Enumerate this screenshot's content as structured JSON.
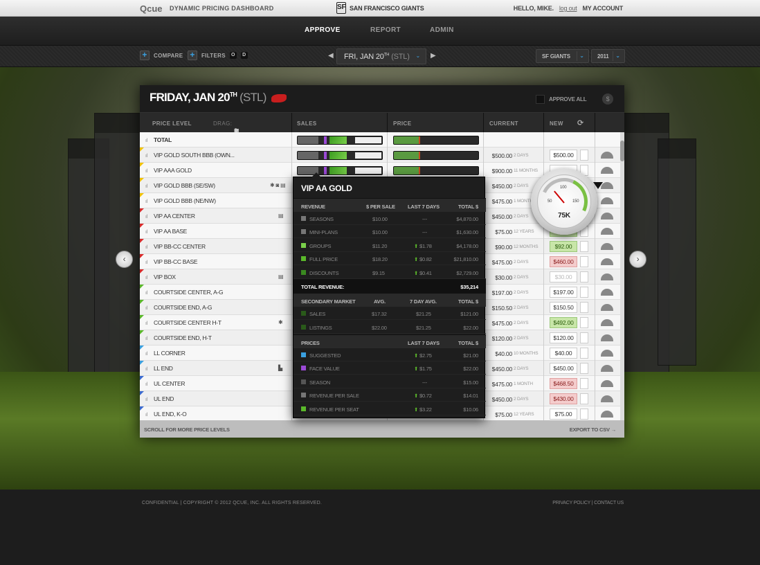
{
  "header": {
    "brand": "Qcue",
    "brand_sub": "DYNAMIC PRICING DASHBOARD",
    "team": "SAN FRANCISCO GIANTS",
    "team_logo": "SF",
    "greeting": "HELLO, MIKE.",
    "logout": "log out",
    "account": "MY ACCOUNT"
  },
  "nav": {
    "tabs": [
      "APPROVE",
      "REPORT",
      "ADMIN"
    ],
    "active": "APPROVE"
  },
  "filters": {
    "compare": "COMPARE",
    "filters": "FILTERS",
    "toggle_o": "O",
    "toggle_d": "D",
    "date_main": "FRI, JAN 20",
    "date_sup": "TH",
    "date_opp": "(STL)",
    "team_select": "SF GIANTS",
    "year_select": "2011"
  },
  "card": {
    "title_main": "FRIDAY, JAN 20",
    "title_sup": "TH",
    "title_opp": "(STL)",
    "approve_all": "APPROVE ALL",
    "dollar": "$",
    "columns": {
      "price_level": "PRICE LEVEL",
      "drag": "DRAG:",
      "sales": "SALES",
      "price": "PRICE",
      "current": "CURRENT",
      "new": "NEW"
    },
    "scroll_more": "SCROLL FOR MORE PRICE LEVELS",
    "export": "EXPORT TO CSV →"
  },
  "rows": [
    {
      "name": "TOTAL",
      "current": "",
      "days": "",
      "new": "",
      "bold": true,
      "mark": ""
    },
    {
      "name": "VIP GOLD SOUTH BBB (OWN...",
      "current": "$500.00",
      "days": "2 DAYS",
      "new": "$500.00",
      "state": "",
      "mark": "#f2c200"
    },
    {
      "name": "VIP AAA GOLD",
      "current": "$900.00",
      "days": "11 MONTHS",
      "new": "",
      "state": "",
      "mark": "#f2c200"
    },
    {
      "name": "VIP GOLD BBB (SE/SW)",
      "current": "$450.00",
      "days": "2 DAYS",
      "new": "",
      "state": "",
      "mark": "#f2c200",
      "icons": "✱ ◙ ▤"
    },
    {
      "name": "VIP GOLD BBB (NE/NW)",
      "current": "$475.00",
      "days": "1 MONTH",
      "new": "",
      "state": "",
      "mark": "#f2c200"
    },
    {
      "name": "VIP AA CENTER",
      "current": "$450.00",
      "days": "2 DAYS",
      "new": "",
      "state": "",
      "mark": "#d92a2a",
      "icons": "▤"
    },
    {
      "name": "VIP AA BASE",
      "current": "$75.00",
      "days": "12 YEARS",
      "new": "$89.50",
      "state": "green",
      "mark": "#d92a2a"
    },
    {
      "name": "VIP BB-CC CENTER",
      "current": "$90.00",
      "days": "12 MONTHS",
      "new": "$92.00",
      "state": "green",
      "mark": "#d92a2a"
    },
    {
      "name": "VIP BB-CC BASE",
      "current": "$475.00",
      "days": "2 DAYS",
      "new": "$460.00",
      "state": "red",
      "mark": "#d92a2a"
    },
    {
      "name": "VIP BOX",
      "current": "$30.00",
      "days": "2 DAYS",
      "new": "$30.00",
      "state": "dim",
      "mark": "#d92a2a",
      "icons": "▤"
    },
    {
      "name": "COURTSIDE CENTER, A-G",
      "current": "$197.00",
      "days": "2 DAYS",
      "new": "$197.00",
      "state": "",
      "mark": "#5ab82a"
    },
    {
      "name": "COURTSIDE END, A-G",
      "current": "$150.50",
      "days": "2 DAYS",
      "new": "$150.50",
      "state": "",
      "mark": "#5ab82a"
    },
    {
      "name": "COURTSIDE CENTER H-T",
      "current": "$475.00",
      "days": "2 DAYS",
      "new": "$492.00",
      "state": "green",
      "mark": "#5ab82a",
      "icons": "✱"
    },
    {
      "name": "COURTSIDE END, H-T",
      "current": "$120.00",
      "days": "2 DAYS",
      "new": "$120.00",
      "state": "",
      "mark": "#5ab82a"
    },
    {
      "name": "LL CORNER",
      "current": "$40.00",
      "days": "10 MONTHS",
      "new": "$40.00",
      "state": "",
      "mark": "#3aa0e0"
    },
    {
      "name": "LL END",
      "current": "$450.00",
      "days": "2 DAYS",
      "new": "$450.00",
      "state": "",
      "mark": "#3aa0e0",
      "icons": "▙"
    },
    {
      "name": "UL CENTER",
      "current": "$475.00",
      "days": "1 MONTH",
      "new": "$468.50",
      "state": "red",
      "mark": "#3a6ad0"
    },
    {
      "name": "UL END",
      "current": "$450.00",
      "days": "2 DAYS",
      "new": "$430.00",
      "state": "red",
      "mark": "#3a6ad0"
    },
    {
      "name": "UL END, K-O",
      "current": "$75.00",
      "days": "12 YEARS",
      "new": "$75.00",
      "state": "",
      "mark": "#3a6ad0"
    }
  ],
  "popup": {
    "title": "VIP AA GOLD",
    "revenue_hd": {
      "c1": "REVENUE",
      "c2": "$ PER SALE",
      "c3": "LAST 7 DAYS",
      "c4": "TOTAL $"
    },
    "revenue": [
      {
        "label": "SEASONS",
        "per": "$10.00",
        "last7": "---",
        "total": "$4,870.00",
        "color": "#777",
        "up": false
      },
      {
        "label": "MINI-PLANS",
        "per": "$10.00",
        "last7": "---",
        "total": "$1,630.00",
        "color": "#777",
        "up": false
      },
      {
        "label": "GROUPS",
        "per": "$11.20",
        "last7": "$1.78",
        "total": "$4,178.00",
        "color": "#7ad04a",
        "up": true
      },
      {
        "label": "FULL PRICE",
        "per": "$18.20",
        "last7": "$0.82",
        "total": "$21,810.00",
        "color": "#5ab82a",
        "up": true
      },
      {
        "label": "DISCOUNTS",
        "per": "$9.15",
        "last7": "$0.41",
        "total": "$2,729.00",
        "color": "#3a8a20",
        "up": true
      }
    ],
    "total_label": "TOTAL REVENUE:",
    "total_value": "$35,214",
    "secondary_hd": {
      "c1": "SECONDARY MARKET",
      "c2": "AVG.",
      "c3": "7 DAY AVG.",
      "c4": "TOTAL $"
    },
    "secondary": [
      {
        "label": "SALES",
        "avg": "$17.32",
        "avg7": "$21.25",
        "total": "$121.00",
        "color": "#2a5a1a"
      },
      {
        "label": "LISTINGS",
        "avg": "$22.00",
        "avg7": "$21.25",
        "total": "$22.00",
        "color": "#2a5a1a"
      }
    ],
    "prices_hd": {
      "c1": "PRICES",
      "c3": "LAST 7 DAYS",
      "c4": "TOTAL $"
    },
    "prices": [
      {
        "label": "SUGGESTED",
        "last7": "$2.75",
        "total": "$21.00",
        "color": "#3aa0e0",
        "up": true
      },
      {
        "label": "FACE VALUE",
        "last7": "$1.75",
        "total": "$22.00",
        "color": "#9b4ad6",
        "up": true
      },
      {
        "label": "SEASON",
        "last7": "---",
        "total": "$15.00",
        "color": "#555",
        "up": false
      },
      {
        "label": "REVENUE PER SALE",
        "last7": "$0.72",
        "total": "$14.01",
        "color": "#777",
        "up": true
      },
      {
        "label": "REVENUE PER SEAT",
        "last7": "$3.22",
        "total": "$10.06",
        "color": "#5ab82a",
        "up": true
      }
    ]
  },
  "gauge": {
    "t50": "50",
    "t100": "100",
    "t150": "150",
    "value": "75K"
  },
  "footer": {
    "left": "CONFIDENTIAL  |  COPYRIGHT © 2012 QCUE, INC. ALL RIGHTS RESERVED.",
    "right": "PRIVACY POLICY | CONTACT US"
  },
  "colors": {
    "accent": "#3aa0e0",
    "green": "#5ab82a",
    "red": "#d92a2a",
    "purple": "#9b4ad6"
  }
}
